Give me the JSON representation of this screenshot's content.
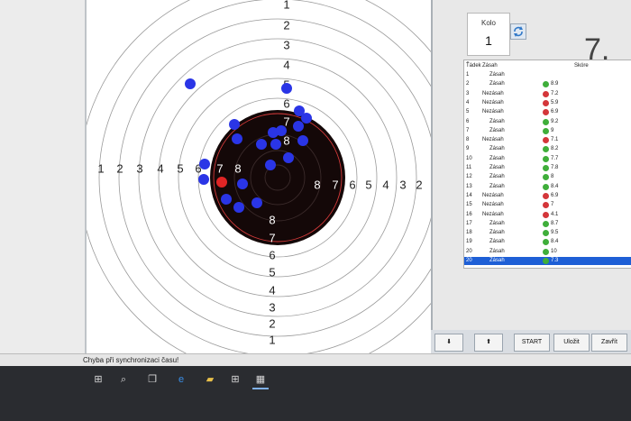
{
  "target": {
    "ring_labels_top": [
      "1",
      "2",
      "3",
      "4",
      "5",
      "6",
      "7",
      "8"
    ],
    "ring_labels_bottom": [
      "8",
      "7",
      "6",
      "5",
      "4",
      "3",
      "2",
      "1"
    ],
    "ring_labels_left": [
      "1",
      "2",
      "3",
      "4",
      "5",
      "6",
      "7",
      "8"
    ],
    "ring_labels_right": [
      "8",
      "7",
      "6",
      "5",
      "4",
      "3",
      "2",
      "1"
    ],
    "colors": {
      "shot": "#2a35e6",
      "last_shot": "#e02525",
      "black_zone": "#140808",
      "inner_ring": "#d43a3a",
      "ring_line": "#9a9a9a"
    }
  },
  "panel": {
    "kolo_label": "Kolo",
    "kolo_value": "1",
    "score_big": "7."
  },
  "table": {
    "headers": {
      "id": "Ťádek",
      "result": "Zásah",
      "score": "Skóre"
    },
    "rows": [
      {
        "id": "1",
        "result": "Zásah",
        "score": "",
        "status": "none"
      },
      {
        "id": "2",
        "result": "Zásah",
        "score": "8.9",
        "status": "green"
      },
      {
        "id": "3",
        "result": "Nezásah",
        "score": "7.2",
        "status": "red"
      },
      {
        "id": "4",
        "result": "Nezásah",
        "score": "5.9",
        "status": "red"
      },
      {
        "id": "5",
        "result": "Nezásah",
        "score": "6.9",
        "status": "red"
      },
      {
        "id": "6",
        "result": "Zásah",
        "score": "9.2",
        "status": "green"
      },
      {
        "id": "7",
        "result": "Zásah",
        "score": "9",
        "status": "green"
      },
      {
        "id": "8",
        "result": "Nezásah",
        "score": "7.1",
        "status": "red"
      },
      {
        "id": "9",
        "result": "Zásah",
        "score": "8.2",
        "status": "green"
      },
      {
        "id": "10",
        "result": "Zásah",
        "score": "7.7",
        "status": "green"
      },
      {
        "id": "11",
        "result": "Zásah",
        "score": "7.8",
        "status": "green"
      },
      {
        "id": "12",
        "result": "Zásah",
        "score": "8",
        "status": "green"
      },
      {
        "id": "13",
        "result": "Zásah",
        "score": "8.4",
        "status": "green"
      },
      {
        "id": "14",
        "result": "Nezásah",
        "score": "6.9",
        "status": "red"
      },
      {
        "id": "15",
        "result": "Nezásah",
        "score": "7",
        "status": "red"
      },
      {
        "id": "16",
        "result": "Nezásah",
        "score": "4.1",
        "status": "red"
      },
      {
        "id": "17",
        "result": "Zásah",
        "score": "8.7",
        "status": "green"
      },
      {
        "id": "18",
        "result": "Zásah",
        "score": "9.5",
        "status": "green"
      },
      {
        "id": "19",
        "result": "Zásah",
        "score": "8.4",
        "status": "green"
      },
      {
        "id": "20",
        "result": "Zásah",
        "score": "10",
        "status": "green"
      },
      {
        "id": "20",
        "result": "Zásah",
        "score": "7.3",
        "status": "green",
        "selected": true
      }
    ]
  },
  "buttons": {
    "down": "⬇",
    "up": "⬆",
    "start": "START",
    "save": "Uložit",
    "close": "Zavřít"
  },
  "status": {
    "message": "Chyba při synchronizaci času!"
  },
  "taskbar": {
    "start": "⊞",
    "search": "⌕",
    "taskview": "❐",
    "edge": "e",
    "explorer": "▰",
    "store": "⊞",
    "app": "▦"
  }
}
